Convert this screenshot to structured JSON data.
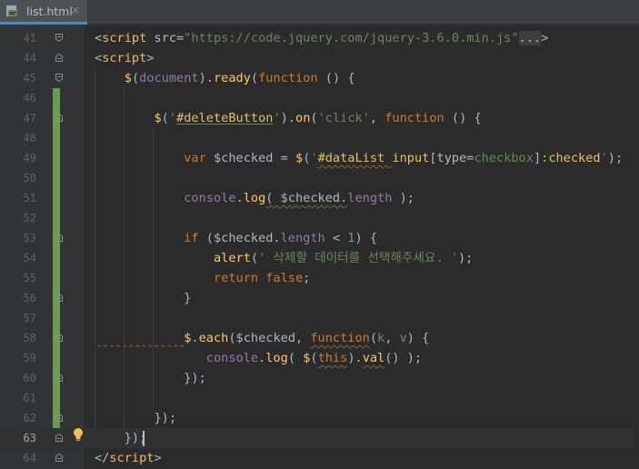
{
  "tab": {
    "filename": "list.html",
    "close": "×",
    "icon": "html-file-icon"
  },
  "line_numbers": [
    "41",
    "44",
    "45",
    "46",
    "47",
    "48",
    "49",
    "50",
    "51",
    "52",
    "53",
    "54",
    "55",
    "56",
    "57",
    "58",
    "59",
    "60",
    "61",
    "62",
    "63",
    "64"
  ],
  "active_line": "63",
  "code_lines": [
    [
      [
        "t",
        "<"
      ],
      [
        "tag",
        "script"
      ],
      [
        "t",
        " "
      ],
      [
        "attr",
        "src"
      ],
      [
        "t",
        "="
      ],
      [
        "s",
        "\"https://code.jquery.com/jquery-3.6.0.min.js\""
      ],
      [
        "ell",
        "..."
      ],
      [
        "t",
        ">"
      ]
    ],
    [
      [
        "t",
        "<"
      ],
      [
        "tag",
        "script"
      ],
      [
        "t",
        ">"
      ]
    ],
    [
      [
        "t",
        "    "
      ],
      [
        "fn",
        "$"
      ],
      [
        "t",
        "("
      ],
      [
        "id",
        "document"
      ],
      [
        "t",
        ")."
      ],
      [
        "fn",
        "ready"
      ],
      [
        "t",
        "("
      ],
      [
        "k",
        "function"
      ],
      [
        "t",
        " () {"
      ]
    ],
    [],
    [
      [
        "t",
        "        "
      ],
      [
        "fn",
        "$"
      ],
      [
        "t",
        "("
      ],
      [
        "s",
        "'"
      ],
      [
        "sel",
        "#deleteButton"
      ],
      [
        "s",
        "'"
      ],
      [
        "t",
        ")."
      ],
      [
        "fn",
        "on"
      ],
      [
        "t",
        "("
      ],
      [
        "s",
        "'click'"
      ],
      [
        "t",
        ", "
      ],
      [
        "k",
        "function"
      ],
      [
        "t",
        " () {"
      ]
    ],
    [],
    [
      [
        "t",
        "            "
      ],
      [
        "k",
        "var"
      ],
      [
        "t",
        " $checked = "
      ],
      [
        "fn",
        "$"
      ],
      [
        "t",
        "("
      ],
      [
        "s",
        "'"
      ],
      [
        "sel",
        "#dataList "
      ],
      [
        "tag",
        "input"
      ],
      [
        "t",
        "["
      ],
      [
        "attr",
        "type"
      ],
      [
        "t",
        "="
      ],
      [
        "s",
        "checkbox"
      ],
      [
        "t",
        "]:"
      ],
      [
        "sel",
        "checked"
      ],
      [
        "s",
        "'"
      ],
      [
        "t",
        ");"
      ]
    ],
    [],
    [
      [
        "t",
        "            "
      ],
      [
        "id",
        "console"
      ],
      [
        "t",
        "."
      ],
      [
        "fn",
        "log"
      ],
      [
        "t",
        "( $checked."
      ],
      [
        "prop",
        "length"
      ],
      [
        "t",
        " );"
      ]
    ],
    [],
    [
      [
        "t",
        "            "
      ],
      [
        "k",
        "if"
      ],
      [
        "t",
        " ($checked."
      ],
      [
        "prop",
        "length"
      ],
      [
        "t",
        " < "
      ],
      [
        "num",
        "1"
      ],
      [
        "t",
        ") {"
      ]
    ],
    [
      [
        "t",
        "                "
      ],
      [
        "fn",
        "alert"
      ],
      [
        "t",
        "("
      ],
      [
        "s",
        "' 삭제할 데이터를 선택해주세요. '"
      ],
      [
        "t",
        ");"
      ]
    ],
    [
      [
        "t",
        "                "
      ],
      [
        "k",
        "return false"
      ],
      [
        "t",
        ";"
      ]
    ],
    [
      [
        "t",
        "            }"
      ]
    ],
    [],
    [
      [
        "t",
        "            "
      ],
      [
        "fn",
        "$"
      ],
      [
        "t",
        "."
      ],
      [
        "fn",
        "each"
      ],
      [
        "t",
        "($checked, "
      ],
      [
        "k",
        "function"
      ],
      [
        "t",
        "("
      ],
      [
        "mute",
        "k"
      ],
      [
        "t",
        ", "
      ],
      [
        "mute",
        "v"
      ],
      [
        "t",
        ") {"
      ]
    ],
    [
      [
        "t",
        "               "
      ],
      [
        "id",
        "console"
      ],
      [
        "t",
        "."
      ],
      [
        "fn",
        "log"
      ],
      [
        "t",
        "( "
      ],
      [
        "fn",
        "$"
      ],
      [
        "t",
        "("
      ],
      [
        "k",
        "this"
      ],
      [
        "t",
        ")."
      ],
      [
        "fn",
        "val"
      ],
      [
        "t",
        "() );"
      ]
    ],
    [
      [
        "t",
        "            });"
      ]
    ],
    [],
    [
      [
        "t",
        "        });"
      ]
    ],
    [
      [
        "t",
        "    });"
      ]
    ],
    [
      [
        "t",
        "</"
      ],
      [
        "tag",
        "script"
      ],
      [
        "t",
        ">"
      ]
    ]
  ],
  "fold_markers": [
    "open",
    "close",
    "open",
    "none",
    "close",
    "none",
    "none",
    "none",
    "none",
    "none",
    "close",
    "none",
    "none",
    "close",
    "none",
    "close",
    "none",
    "close",
    "none",
    "close",
    "close",
    "close"
  ],
  "icons": {
    "intention": "lightbulb-icon",
    "fold": "fold-marker-icon"
  },
  "colors": {
    "background": "#2b2b2b",
    "gutter": "#313335",
    "keyword": "#cc7832",
    "string": "#6a8759",
    "vcs_added": "#6a9b4f"
  }
}
